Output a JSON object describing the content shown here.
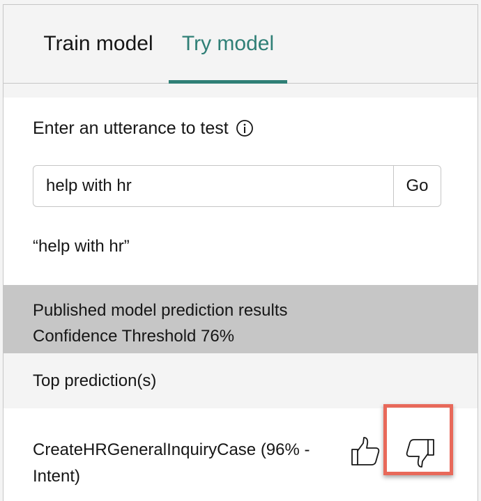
{
  "tabs": [
    {
      "label": "Train model",
      "active": false
    },
    {
      "label": "Try model",
      "active": true
    }
  ],
  "utterance": {
    "label": "Enter an utterance to test",
    "info_icon": "info-icon",
    "input_value": "help with hr",
    "go_label": "Go"
  },
  "echo_text": "“help with hr”",
  "results": {
    "title": "Published model prediction results",
    "threshold": "Confidence Threshold 76%"
  },
  "top_predictions_label": "Top prediction(s)",
  "prediction": {
    "text": "CreateHRGeneralInquiryCase (96% - Intent)",
    "thumbs_up_icon": "thumbs-up-icon",
    "thumbs_down_icon": "thumbs-down-icon"
  },
  "colors": {
    "accent": "#2f7f76",
    "highlight": "#e8695a",
    "header_bg": "#c6c6c6"
  }
}
